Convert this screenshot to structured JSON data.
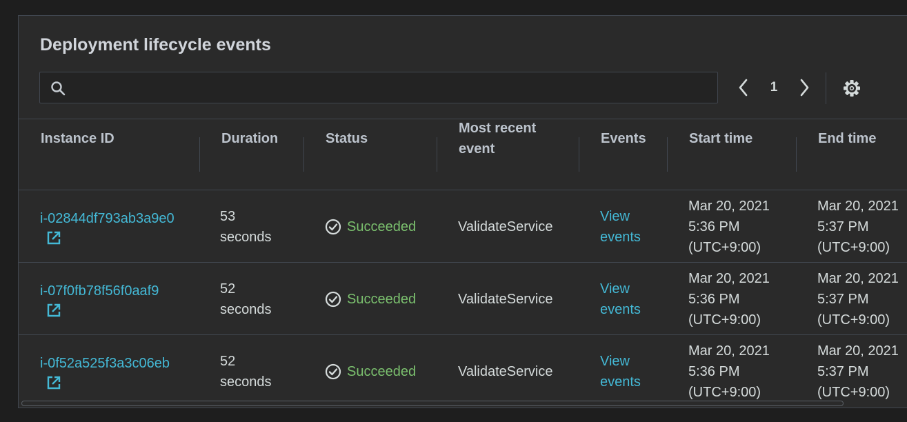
{
  "panel": {
    "title": "Deployment lifecycle events"
  },
  "search": {
    "value": "",
    "placeholder": ""
  },
  "pagination": {
    "current_page": "1"
  },
  "table": {
    "headers": {
      "instance_id": "Instance ID",
      "duration": "Duration",
      "status": "Status",
      "most_recent_event": "Most recent event",
      "events": "Events",
      "start_time": "Start time",
      "end_time": "End time"
    },
    "rows": [
      {
        "instance_id": "i-02844df793ab3a9e0",
        "duration": "53 seconds",
        "status": "Succeeded",
        "most_recent_event": "ValidateService",
        "events_link": "View events",
        "start_time": [
          "Mar 20, 2021",
          "5:36 PM",
          "(UTC+9:00)"
        ],
        "end_time": [
          "Mar 20, 2021",
          "5:37 PM",
          "(UTC+9:00)"
        ]
      },
      {
        "instance_id": "i-07f0fb78f56f0aaf9",
        "duration": "52 seconds",
        "status": "Succeeded",
        "most_recent_event": "ValidateService",
        "events_link": "View events",
        "start_time": [
          "Mar 20, 2021",
          "5:36 PM",
          "(UTC+9:00)"
        ],
        "end_time": [
          "Mar 20, 2021",
          "5:37 PM",
          "(UTC+9:00)"
        ]
      },
      {
        "instance_id": "i-0f52a525f3a3c06eb",
        "duration": "52 seconds",
        "status": "Succeeded",
        "most_recent_event": "ValidateService",
        "events_link": "View events",
        "start_time": [
          "Mar 20, 2021",
          "5:36 PM",
          "(UTC+9:00)"
        ],
        "end_time": [
          "Mar 20, 2021",
          "5:37 PM",
          "(UTC+9:00)"
        ]
      }
    ]
  },
  "icons": {
    "search": "search-icon",
    "prev_page": "chevron-left-icon",
    "next_page": "chevron-right-icon",
    "settings": "gear-icon",
    "external_link": "external-link-icon",
    "status_success": "check-circle-icon"
  },
  "colors": {
    "background": "#1e1e1e",
    "panel": "#2a2a2a",
    "link": "#44b9d6",
    "success": "#7bc06e",
    "border": "#414750"
  }
}
